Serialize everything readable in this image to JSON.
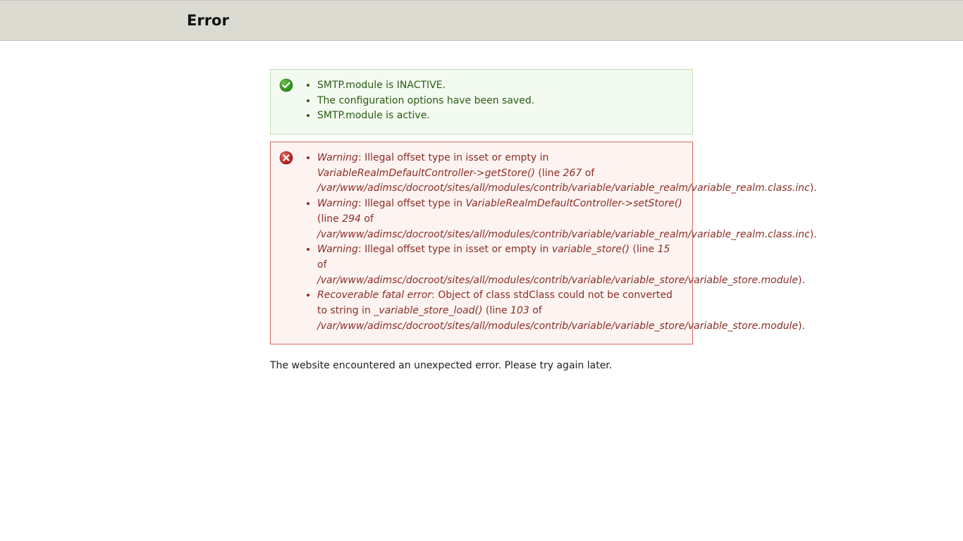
{
  "header": {
    "title": "Error"
  },
  "status_messages": [
    "SMTP.module is INACTIVE.",
    "The configuration options have been saved.",
    "SMTP.module is active."
  ],
  "error_messages": [
    {
      "label": "Warning",
      "text1": ": Illegal offset type in isset or empty in ",
      "fn": "VariableRealmDefaultController->getStore()",
      "text2": " (line ",
      "line": "267",
      "text3": " of ",
      "path": "/var/www/adimsc/docroot/sites/all/modules/contrib/variable/variable_realm/variable_realm.class.inc",
      "text4": ")."
    },
    {
      "label": "Warning",
      "text1": ": Illegal offset type in ",
      "fn": "VariableRealmDefaultController->setStore()",
      "text2": " (line ",
      "line": "294",
      "text3": " of ",
      "path": "/var/www/adimsc/docroot/sites/all/modules/contrib/variable/variable_realm/variable_realm.class.inc",
      "text4": ")."
    },
    {
      "label": "Warning",
      "text1": ": Illegal offset type in isset or empty in ",
      "fn": "variable_store()",
      "text2": " (line ",
      "line": "15",
      "text3": " of ",
      "path": "/var/www/adimsc/docroot/sites/all/modules/contrib/variable/variable_store/variable_store.module",
      "text4": ")."
    },
    {
      "label": "Recoverable fatal error",
      "text1": ": Object of class stdClass could not be converted to string in ",
      "fn": "_variable_store_load()",
      "text2": " (line ",
      "line": "103",
      "text3": " of ",
      "path": "/var/www/adimsc/docroot/sites/all/modules/contrib/variable/variable_store/variable_store.module",
      "text4": ")."
    }
  ],
  "page_message": "The website encountered an unexpected error. Please try again later."
}
